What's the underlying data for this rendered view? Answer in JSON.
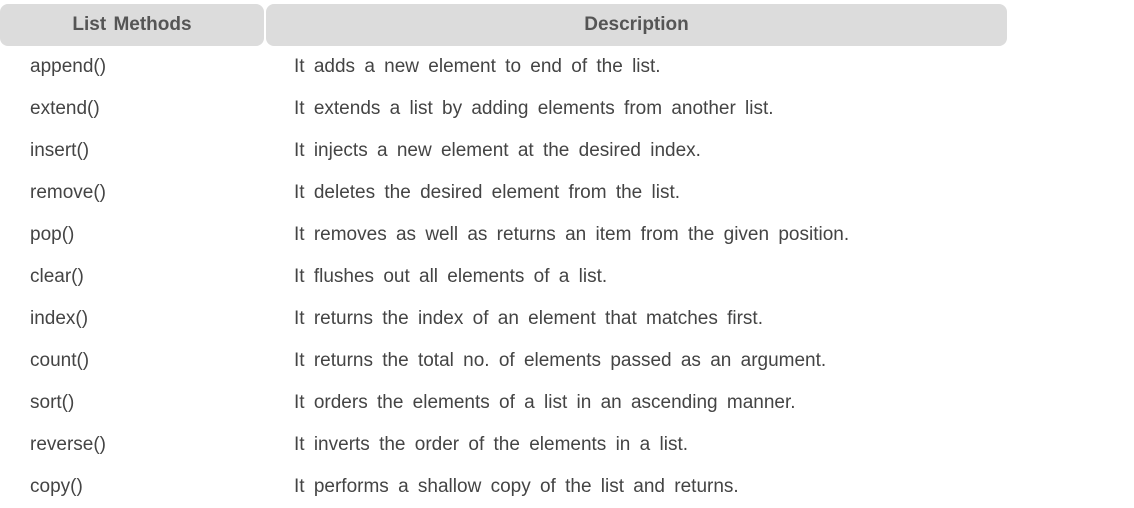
{
  "table": {
    "headers": {
      "methods": "List Methods",
      "description": "Description"
    },
    "rows": [
      {
        "method": "append()",
        "description": "It adds a new element to end of the list."
      },
      {
        "method": "extend()",
        "description": "It extends a list by adding elements from another list."
      },
      {
        "method": "insert()",
        "description": "It injects a new element at the desired index."
      },
      {
        "method": "remove()",
        "description": "It deletes the desired element from the list."
      },
      {
        "method": "pop()",
        "description": "It removes as well as returns an item from the given position."
      },
      {
        "method": "clear()",
        "description": "It flushes out all elements of a list."
      },
      {
        "method": "index()",
        "description": "It returns the index of an element that matches first."
      },
      {
        "method": "count()",
        "description": "It returns the total no. of elements passed as an argument."
      },
      {
        "method": "sort()",
        "description": "It orders the elements of a list in an ascending manner."
      },
      {
        "method": "reverse()",
        "description": "It inverts the order of the elements in a list."
      },
      {
        "method": "copy()",
        "description": "It performs a shallow copy of the list and returns."
      }
    ]
  }
}
